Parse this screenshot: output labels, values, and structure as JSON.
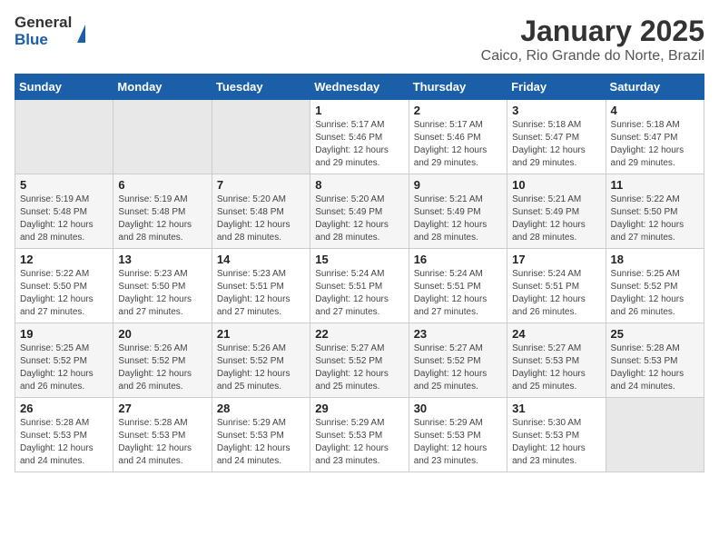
{
  "logo": {
    "text_general": "General",
    "text_blue": "Blue"
  },
  "header": {
    "title": "January 2025",
    "subtitle": "Caico, Rio Grande do Norte, Brazil"
  },
  "weekdays": [
    "Sunday",
    "Monday",
    "Tuesday",
    "Wednesday",
    "Thursday",
    "Friday",
    "Saturday"
  ],
  "weeks": [
    [
      {
        "day": "",
        "info": ""
      },
      {
        "day": "",
        "info": ""
      },
      {
        "day": "",
        "info": ""
      },
      {
        "day": "1",
        "info": "Sunrise: 5:17 AM\nSunset: 5:46 PM\nDaylight: 12 hours\nand 29 minutes."
      },
      {
        "day": "2",
        "info": "Sunrise: 5:17 AM\nSunset: 5:46 PM\nDaylight: 12 hours\nand 29 minutes."
      },
      {
        "day": "3",
        "info": "Sunrise: 5:18 AM\nSunset: 5:47 PM\nDaylight: 12 hours\nand 29 minutes."
      },
      {
        "day": "4",
        "info": "Sunrise: 5:18 AM\nSunset: 5:47 PM\nDaylight: 12 hours\nand 29 minutes."
      }
    ],
    [
      {
        "day": "5",
        "info": "Sunrise: 5:19 AM\nSunset: 5:48 PM\nDaylight: 12 hours\nand 28 minutes."
      },
      {
        "day": "6",
        "info": "Sunrise: 5:19 AM\nSunset: 5:48 PM\nDaylight: 12 hours\nand 28 minutes."
      },
      {
        "day": "7",
        "info": "Sunrise: 5:20 AM\nSunset: 5:48 PM\nDaylight: 12 hours\nand 28 minutes."
      },
      {
        "day": "8",
        "info": "Sunrise: 5:20 AM\nSunset: 5:49 PM\nDaylight: 12 hours\nand 28 minutes."
      },
      {
        "day": "9",
        "info": "Sunrise: 5:21 AM\nSunset: 5:49 PM\nDaylight: 12 hours\nand 28 minutes."
      },
      {
        "day": "10",
        "info": "Sunrise: 5:21 AM\nSunset: 5:49 PM\nDaylight: 12 hours\nand 28 minutes."
      },
      {
        "day": "11",
        "info": "Sunrise: 5:22 AM\nSunset: 5:50 PM\nDaylight: 12 hours\nand 27 minutes."
      }
    ],
    [
      {
        "day": "12",
        "info": "Sunrise: 5:22 AM\nSunset: 5:50 PM\nDaylight: 12 hours\nand 27 minutes."
      },
      {
        "day": "13",
        "info": "Sunrise: 5:23 AM\nSunset: 5:50 PM\nDaylight: 12 hours\nand 27 minutes."
      },
      {
        "day": "14",
        "info": "Sunrise: 5:23 AM\nSunset: 5:51 PM\nDaylight: 12 hours\nand 27 minutes."
      },
      {
        "day": "15",
        "info": "Sunrise: 5:24 AM\nSunset: 5:51 PM\nDaylight: 12 hours\nand 27 minutes."
      },
      {
        "day": "16",
        "info": "Sunrise: 5:24 AM\nSunset: 5:51 PM\nDaylight: 12 hours\nand 27 minutes."
      },
      {
        "day": "17",
        "info": "Sunrise: 5:24 AM\nSunset: 5:51 PM\nDaylight: 12 hours\nand 26 minutes."
      },
      {
        "day": "18",
        "info": "Sunrise: 5:25 AM\nSunset: 5:52 PM\nDaylight: 12 hours\nand 26 minutes."
      }
    ],
    [
      {
        "day": "19",
        "info": "Sunrise: 5:25 AM\nSunset: 5:52 PM\nDaylight: 12 hours\nand 26 minutes."
      },
      {
        "day": "20",
        "info": "Sunrise: 5:26 AM\nSunset: 5:52 PM\nDaylight: 12 hours\nand 26 minutes."
      },
      {
        "day": "21",
        "info": "Sunrise: 5:26 AM\nSunset: 5:52 PM\nDaylight: 12 hours\nand 25 minutes."
      },
      {
        "day": "22",
        "info": "Sunrise: 5:27 AM\nSunset: 5:52 PM\nDaylight: 12 hours\nand 25 minutes."
      },
      {
        "day": "23",
        "info": "Sunrise: 5:27 AM\nSunset: 5:52 PM\nDaylight: 12 hours\nand 25 minutes."
      },
      {
        "day": "24",
        "info": "Sunrise: 5:27 AM\nSunset: 5:53 PM\nDaylight: 12 hours\nand 25 minutes."
      },
      {
        "day": "25",
        "info": "Sunrise: 5:28 AM\nSunset: 5:53 PM\nDaylight: 12 hours\nand 24 minutes."
      }
    ],
    [
      {
        "day": "26",
        "info": "Sunrise: 5:28 AM\nSunset: 5:53 PM\nDaylight: 12 hours\nand 24 minutes."
      },
      {
        "day": "27",
        "info": "Sunrise: 5:28 AM\nSunset: 5:53 PM\nDaylight: 12 hours\nand 24 minutes."
      },
      {
        "day": "28",
        "info": "Sunrise: 5:29 AM\nSunset: 5:53 PM\nDaylight: 12 hours\nand 24 minutes."
      },
      {
        "day": "29",
        "info": "Sunrise: 5:29 AM\nSunset: 5:53 PM\nDaylight: 12 hours\nand 23 minutes."
      },
      {
        "day": "30",
        "info": "Sunrise: 5:29 AM\nSunset: 5:53 PM\nDaylight: 12 hours\nand 23 minutes."
      },
      {
        "day": "31",
        "info": "Sunrise: 5:30 AM\nSunset: 5:53 PM\nDaylight: 12 hours\nand 23 minutes."
      },
      {
        "day": "",
        "info": ""
      }
    ]
  ]
}
